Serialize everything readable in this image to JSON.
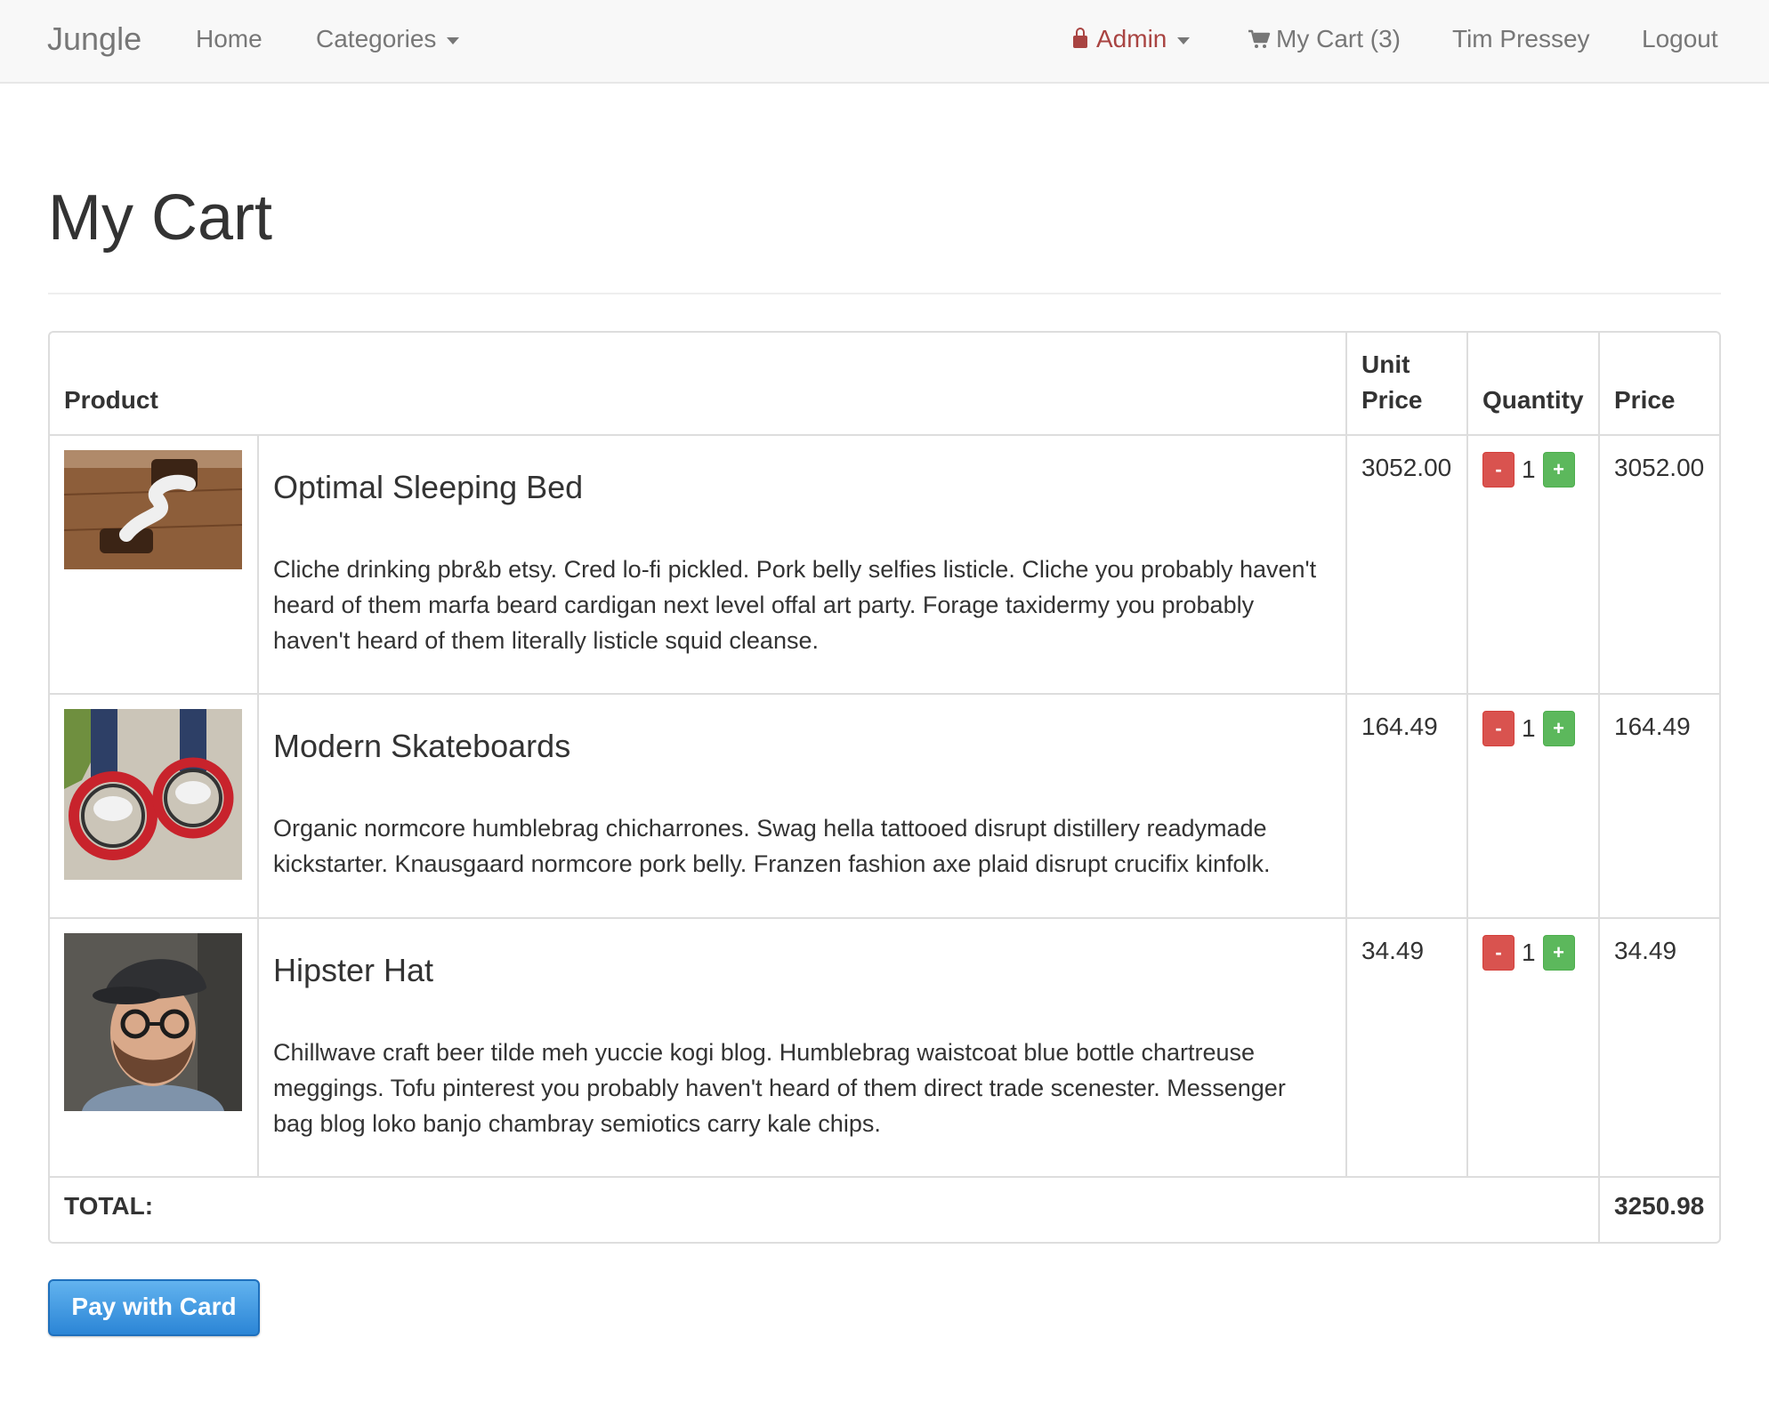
{
  "navbar": {
    "brand": "Jungle",
    "home": "Home",
    "categories": "Categories",
    "admin": "Admin",
    "cart": "My Cart (3)",
    "user": "Tim Pressey",
    "logout": "Logout",
    "admin_color": "#a94442",
    "icons": [
      "lock-icon",
      "shopping-cart-icon",
      "caret-down-icon"
    ]
  },
  "page": {
    "title": "My Cart"
  },
  "table": {
    "headers": {
      "product": "Product",
      "unit_price": "Unit Price",
      "quantity": "Quantity",
      "price": "Price"
    },
    "rows": [
      {
        "name": "Optimal Sleeping Bed",
        "description": "Cliche drinking pbr&b etsy. Cred lo-fi pickled. Pork belly selfies listicle. Cliche you probably haven't heard of them marfa beard cardigan next level offal art party. Forage taxidermy you probably haven't heard of them literally listicle squid cleanse.",
        "unit_price": "3052.00",
        "quantity": "1",
        "price": "3052.00"
      },
      {
        "name": "Modern Skateboards",
        "description": "Organic normcore humblebrag chicharrones. Swag hella tattooed disrupt distillery readymade kickstarter. Knausgaard normcore pork belly. Franzen fashion axe plaid disrupt crucifix kinfolk.",
        "unit_price": "164.49",
        "quantity": "1",
        "price": "164.49"
      },
      {
        "name": "Hipster Hat",
        "description": "Chillwave craft beer tilde meh yuccie kogi blog. Humblebrag waistcoat blue bottle chartreuse meggings. Tofu pinterest you probably haven't heard of them direct trade scenester. Messenger bag blog loko banjo chambray semiotics carry kale chips.",
        "unit_price": "34.49",
        "quantity": "1",
        "price": "34.49"
      }
    ],
    "minus_label": "-",
    "plus_label": "+",
    "total_label": "TOTAL:",
    "total_value": "3250.98"
  },
  "pay_button": {
    "label": "Pay with Card",
    "color": "#2b85d6"
  }
}
